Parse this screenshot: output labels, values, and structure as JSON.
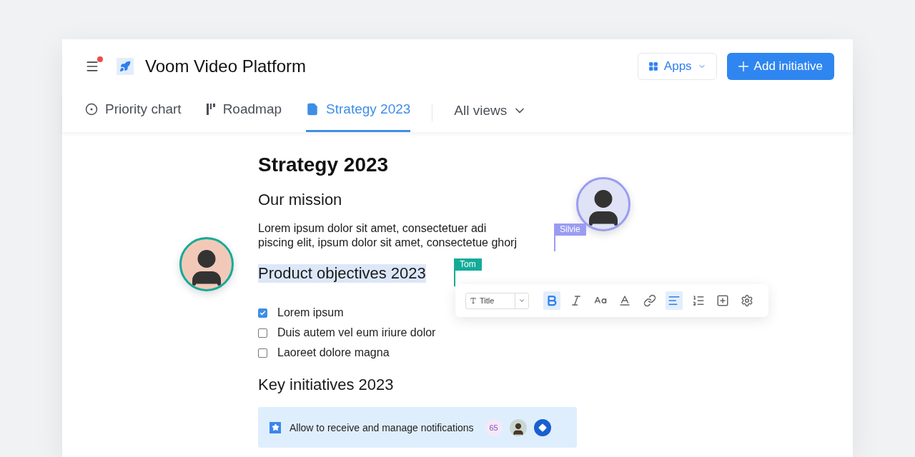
{
  "header": {
    "title": "Voom Video Platform",
    "has_notification": true,
    "apps_label": "Apps",
    "primary_label": "Add initiative"
  },
  "tabs": [
    {
      "label": "Priority chart",
      "kind": "target",
      "selected": false
    },
    {
      "label": "Roadmap",
      "kind": "roadmap",
      "selected": false
    },
    {
      "label": "Strategy 2023",
      "kind": "doc",
      "selected": true
    }
  ],
  "views_menu": {
    "label": "All views"
  },
  "document": {
    "title": "Strategy 2023",
    "mission_heading": "Our mission",
    "mission_lines": [
      "Lorem ipsum dolor sit amet, consectetuer adi",
      "piscing elit, ipsum dolor sit amet, consectetue ghorj"
    ],
    "objectives_heading": "Product objectives 2023",
    "objectives_selected": true,
    "checklist": [
      {
        "label": "Lorem ipsum",
        "checked": true
      },
      {
        "label": "Duis autem vel eum iriure dolor",
        "checked": false
      },
      {
        "label": "Laoreet dolore magna",
        "checked": false
      }
    ],
    "initiatives_heading": "Key initiatives 2023",
    "initiative": {
      "title": "Allow to receive and manage notifications",
      "count": "65"
    }
  },
  "collaborators": [
    {
      "name": "Silvie",
      "color": "#9a9cf2"
    },
    {
      "name": "Tom",
      "color": "#13ab98"
    }
  ],
  "format_toolbar": {
    "style_value": "Title",
    "tools": [
      {
        "kind": "bold",
        "selected": true
      },
      {
        "kind": "italic",
        "selected": false
      },
      {
        "kind": "case",
        "selected": false
      },
      {
        "kind": "color",
        "selected": false
      },
      {
        "kind": "link",
        "selected": false
      },
      {
        "kind": "align",
        "selected": true
      },
      {
        "kind": "list",
        "selected": false
      },
      {
        "kind": "insert",
        "selected": false
      },
      {
        "kind": "settings",
        "selected": false
      }
    ]
  }
}
